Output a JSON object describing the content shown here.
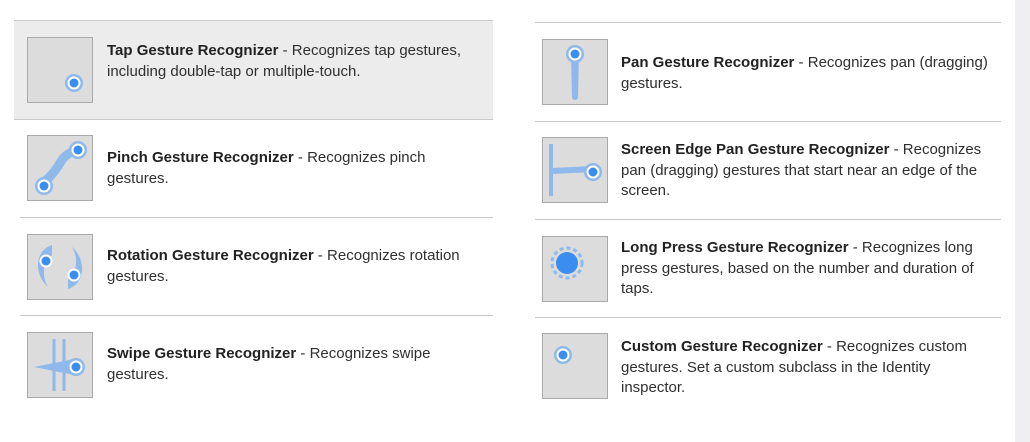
{
  "library": {
    "left": [
      {
        "title": "Tap Gesture Recognizer",
        "sep": " - ",
        "body": "Recognizes tap gestures, including double-tap or multiple-touch.",
        "icon": "tap-icon",
        "selected": true
      },
      {
        "title": "Pinch Gesture Recognizer",
        "sep": " - ",
        "body": "Recognizes pinch gestures.",
        "icon": "pinch-icon"
      },
      {
        "title": "Rotation Gesture Recognizer",
        "sep": " - ",
        "body": "Recognizes rotation gestures.",
        "icon": "rotation-icon"
      },
      {
        "title": "Swipe Gesture Recognizer",
        "sep": " - ",
        "body": "Recognizes swipe gestures.",
        "icon": "swipe-icon"
      }
    ],
    "right": [
      {
        "title": "Pan Gesture Recognizer",
        "sep": " - ",
        "body": "Recognizes pan (dragging) gestures.",
        "icon": "pan-icon"
      },
      {
        "title": "Screen Edge Pan Gesture Recognizer",
        "sep": " - ",
        "body": "Recognizes pan (dragging) gestures that start near an edge of the screen.",
        "icon": "screen-edge-pan-icon"
      },
      {
        "title": "Long Press Gesture Recognizer",
        "sep": " - ",
        "body": "Recognizes long press gestures, based on the number and duration of taps.",
        "icon": "long-press-icon"
      },
      {
        "title": "Custom Gesture Recognizer",
        "sep": " - ",
        "body": "Recognizes custom gestures. Set a custom subclass in the Identity inspector.",
        "icon": "custom-gesture-icon"
      }
    ]
  },
  "colors": {
    "accent": "#3a8ef0",
    "icon_fill": "#8fb9ea",
    "selected_bg": "#ececec",
    "thumb_bg": "#dcdcdc"
  }
}
